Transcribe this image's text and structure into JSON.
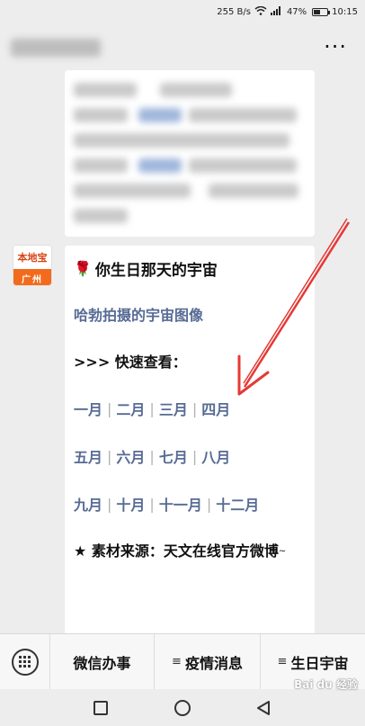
{
  "status_bar": {
    "speed": "255 B/s",
    "battery": "47%",
    "battery_level": 0.47,
    "time": "10:15"
  },
  "header": {
    "more_label": "···"
  },
  "avatar": {
    "top_text": "本地宝",
    "bottom_text": "广州"
  },
  "message": {
    "title": "你生日那天的宇宙",
    "hubble_link": "哈勃拍摄的宇宙图像",
    "quick_view": ">>> 快速查看：",
    "months_row1": [
      "一月",
      "二月",
      "三月",
      "四月"
    ],
    "months_row2": [
      "五月",
      "六月",
      "七月",
      "八月"
    ],
    "months_row3": [
      "九月",
      "十月",
      "十一月",
      "十二月"
    ],
    "source": "★ 素材来源：天文在线官方微博",
    "source_tail": "~"
  },
  "bottom_menu": {
    "item1": "微信办事",
    "item2": "疫情消息",
    "item3": "生日宇宙",
    "lines_icon": "≡"
  },
  "watermark": "Bai du 经验",
  "colors": {
    "link": "#576b95",
    "arrow": "#e53935",
    "bubble": "#ffffff",
    "background": "#ededed"
  }
}
